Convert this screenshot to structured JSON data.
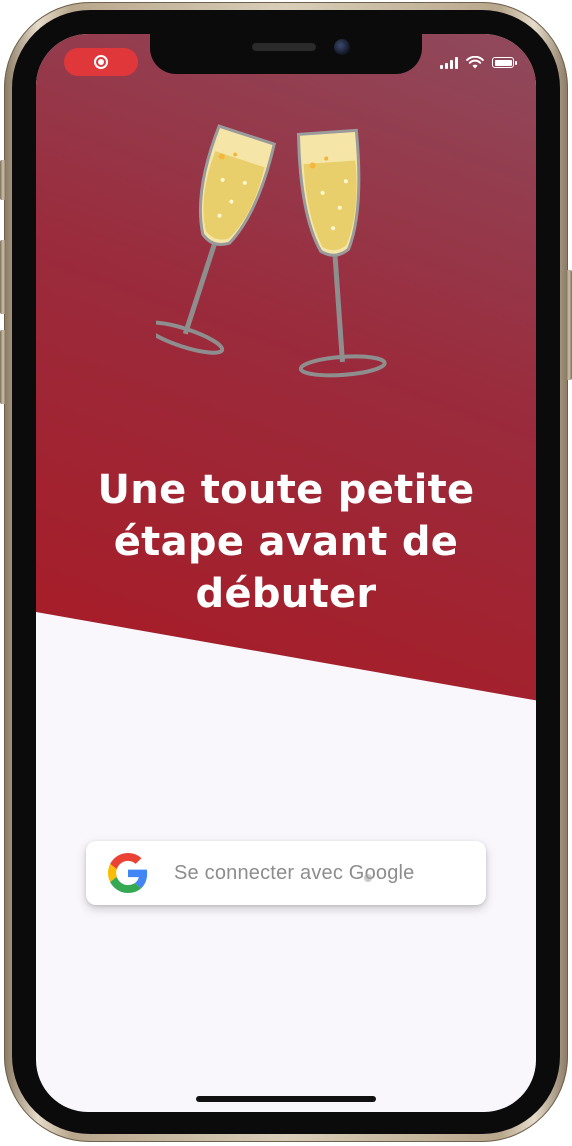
{
  "status_bar": {
    "recording_indicator": "record-icon",
    "icons": [
      "signal-icon",
      "wifi-icon",
      "battery-icon"
    ],
    "recording_color": "#e0383a"
  },
  "hero": {
    "illustration": "champagne-glasses-icon",
    "title": "Une toute petite étape avant de débuter",
    "background_colors": [
      "#8f4a5c",
      "#a91a24"
    ]
  },
  "login": {
    "google_button_label": "Se connecter avec Google",
    "google_icon": "google-g-icon"
  },
  "colors": {
    "brand": "#a91a24",
    "background": "#f9f7fb"
  }
}
